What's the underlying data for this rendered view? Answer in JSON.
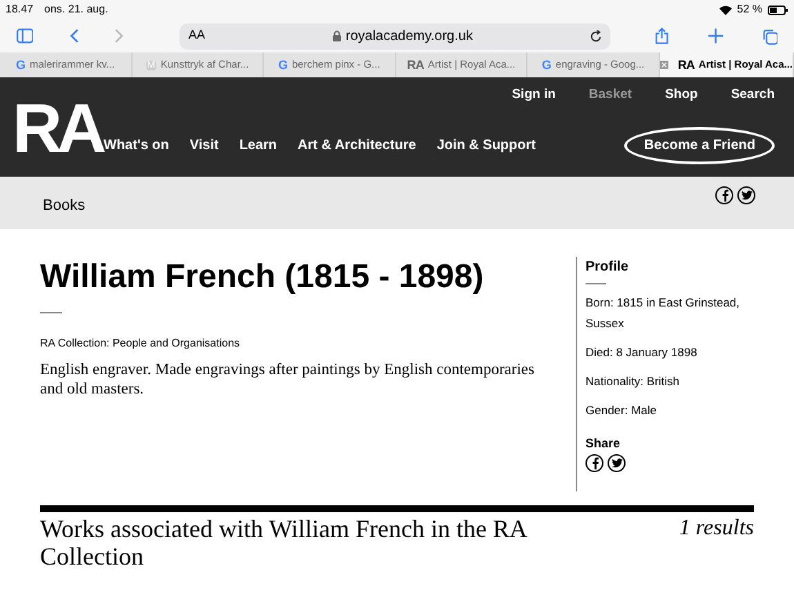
{
  "status_bar": {
    "time": "18.47",
    "date": "ons. 21. aug.",
    "battery": "52 %"
  },
  "browser": {
    "text_size": "AA",
    "url": "royalacademy.org.uk"
  },
  "tabs": [
    {
      "icon": "G",
      "label": "malerirammer kv...",
      "selected": false
    },
    {
      "icon": "M",
      "label": "Kunsttryk af Char...",
      "selected": false
    },
    {
      "icon": "G",
      "label": "berchem pinx - G...",
      "selected": false
    },
    {
      "icon": "RA",
      "label": "Artist | Royal Aca...",
      "selected": false
    },
    {
      "icon": "G",
      "label": "engraving - Goog...",
      "selected": false
    },
    {
      "icon": "RA",
      "label": "Artist | Royal Aca...",
      "selected": true
    }
  ],
  "site": {
    "logo": "RA",
    "utility_links": [
      {
        "label": "Sign in",
        "disabled": false
      },
      {
        "label": "Basket",
        "disabled": true
      },
      {
        "label": "Shop",
        "disabled": false
      },
      {
        "label": "Search",
        "disabled": false
      }
    ],
    "nav": [
      "What's on",
      "Visit",
      "Learn",
      "Art & Architecture",
      "Join & Support"
    ],
    "cta": "Become a Friend"
  },
  "breadcrumb": {
    "label": "Books",
    "share_icons": [
      {
        "kind": "facebook"
      },
      {
        "kind": "twitter"
      }
    ]
  },
  "article": {
    "title": "William French (1815 - 1898)",
    "category": "RA Collection: People and Organisations",
    "description": "English engraver. Made engravings after paintings by English contemporaries and old masters."
  },
  "profile": {
    "heading": "Profile",
    "facts": [
      "Born: 1815 in East Grinstead, Sussex",
      "Died: 8 January 1898",
      "Nationality: British",
      "Gender: Male"
    ],
    "share_heading": "Share",
    "share_icons": [
      {
        "kind": "facebook"
      },
      {
        "kind": "twitter"
      }
    ]
  },
  "works": {
    "heading": "Works associated with William French in the RA Collection",
    "count": "1 results"
  }
}
